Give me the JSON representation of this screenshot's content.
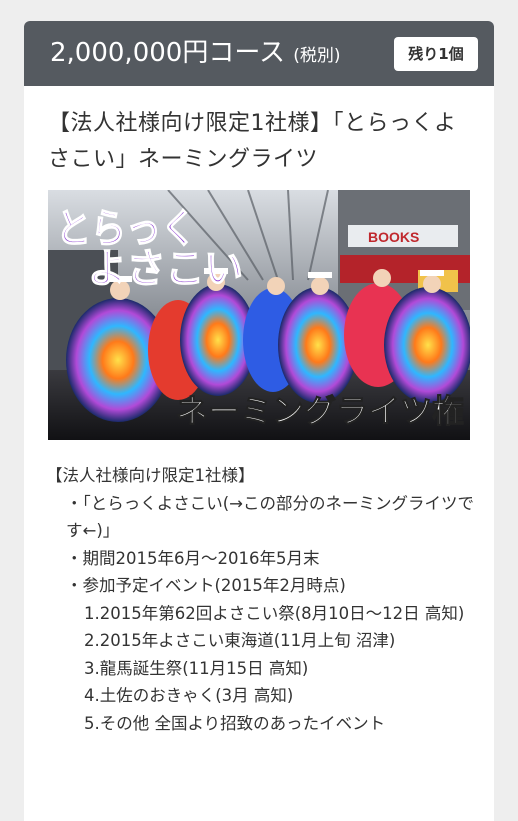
{
  "header": {
    "price": "2,000,000円コース",
    "tax": "(税別)",
    "remaining": "残り1個"
  },
  "title": "【法人社様向け限定1社様】「とらっくよさこい」ネーミングライツ",
  "image": {
    "text_top": "とらっくよさこい",
    "text_bottom": "ネーミングライツ権",
    "sign_text": "BOOKS"
  },
  "description": {
    "heading": "【法人社様向け限定1社様】",
    "item1": "・「とらっくよさこい(→この部分のネーミングライツです←)」",
    "item2": "・期間2015年6月〜2016年5月末",
    "item3": "・参加予定イベント(2015年2月時点)",
    "event1": "1.2015年第62回よさこい祭(8月10日〜12日 高知)",
    "event2": "2.2015年よさこい東海道(11月上旬 沼津)",
    "event3": "3.龍馬誕生祭(11月15日 高知)",
    "event4": "4.土佐のおきゃく(3月 高知)",
    "event5": "5.その他 全国より招致のあったイベント"
  },
  "colors": {
    "header_bg": "#555a60",
    "background": "#eeeeee",
    "text": "#333333"
  }
}
